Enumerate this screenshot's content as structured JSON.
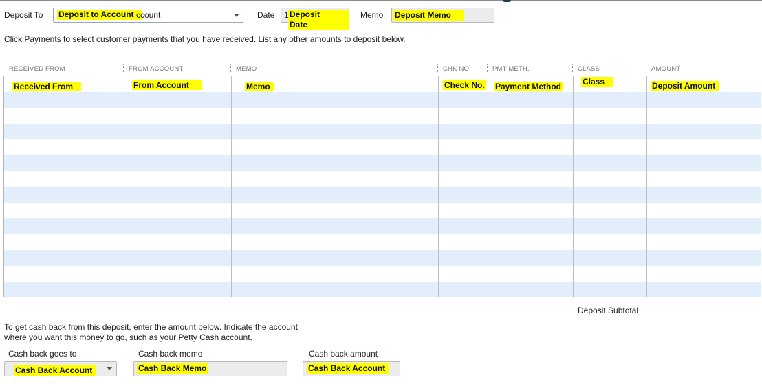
{
  "header": {
    "deposit_to_label": "Deposit To",
    "deposit_to_value": "Deposit to Account",
    "deposit_to_trailing": "ccount",
    "date_label": "Date",
    "date_value": "Deposit Date",
    "date_prefix": "1",
    "memo_label": "Memo",
    "memo_value": "Deposit Memo"
  },
  "instructions": "Click Payments to select customer payments that you have received. List any other amounts to deposit below.",
  "table": {
    "columns": [
      "RECEIVED FROM",
      "FROM ACCOUNT",
      "MEMO",
      "CHK NO.",
      "PMT METH.",
      "CLASS",
      "AMOUNT"
    ],
    "first_row": [
      "Received From",
      "From Account",
      "Memo",
      "Check No.",
      "Payment Method",
      "Class",
      "Deposit Amount"
    ],
    "row_count": 14
  },
  "subtotal_label": "Deposit Subtotal",
  "cash_back": {
    "instructions_line1": "To get cash back from this deposit, enter the amount below.  Indicate the account",
    "instructions_line2": "where you want this money to go, such as your Petty Cash account.",
    "goes_to_label": "Cash back goes to",
    "goes_to_value": "Cash Back Account",
    "memo_label": "Cash back memo",
    "memo_value": "Cash Back Memo",
    "amount_label": "Cash back amount",
    "amount_value": "Cash Back Account"
  },
  "colors": {
    "highlight": "#ffff00",
    "row_alt": "#e3eefc"
  }
}
